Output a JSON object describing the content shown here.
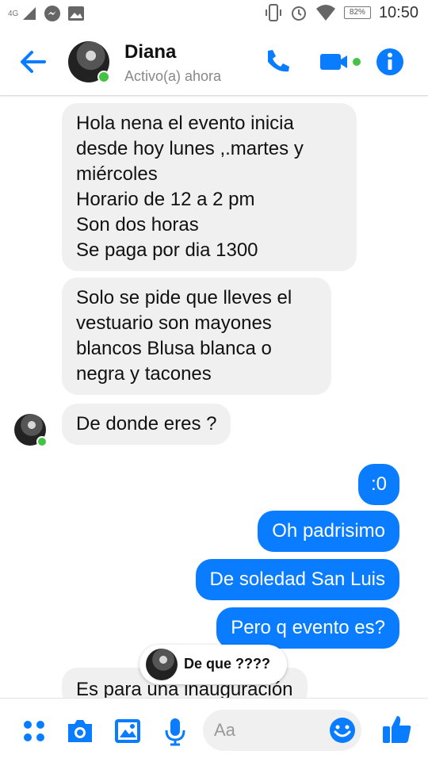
{
  "status_bar": {
    "network": "4G",
    "battery": "82%",
    "time": "10:50"
  },
  "header": {
    "name": "Diana",
    "status": "Activo(a) ahora"
  },
  "messages": {
    "m1": [
      "Hola nena el evento inicia",
      "desde hoy lunes ,.martes y",
      "miércoles",
      "Horario de 12 a 2 pm",
      "Son dos horas",
      "Se paga por dia 1300"
    ],
    "m2": [
      "Solo se pide que lleves el",
      "vestuario son mayones",
      "blancos Blusa blanca o",
      "negra  y tacones"
    ],
    "m3": "De donde eres ?",
    "m4": ":0",
    "m5": "Oh padrisimo",
    "m6": "De soledad San Luis",
    "m7": "Pero q evento es?",
    "m8": "Es para una inauguración"
  },
  "reaction": {
    "text": "De que ????"
  },
  "composer": {
    "placeholder": "Aa"
  },
  "colors": {
    "accent": "#0a7cff",
    "online": "#44c245",
    "incoming_bg": "#f1f0f0"
  }
}
